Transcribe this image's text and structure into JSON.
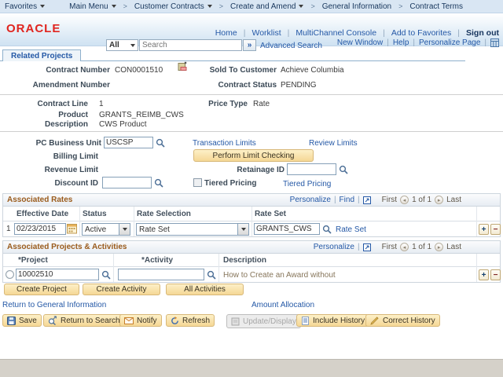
{
  "breadcrumb": {
    "items": [
      {
        "label": "Favorites",
        "has_menu": true
      },
      {
        "label": "Main Menu",
        "has_menu": true
      },
      {
        "label": "Customer Contracts",
        "has_menu": true
      },
      {
        "label": "Create and Amend",
        "has_menu": true
      },
      {
        "label": "General Information",
        "has_menu": false
      },
      {
        "label": "Contract Terms",
        "has_menu": false
      }
    ]
  },
  "header": {
    "logo": "ORACLE",
    "search_scope": "All",
    "search_placeholder": "Search",
    "advanced_search": "Advanced Search",
    "links": [
      "Home",
      "Worklist",
      "MultiChannel Console",
      "Add to Favorites"
    ],
    "sign_out": "Sign out"
  },
  "pagebar": {
    "links": [
      "New Window",
      "Help",
      "Personalize Page"
    ]
  },
  "tab": {
    "label": "Related Projects"
  },
  "contract": {
    "contract_number_label": "Contract Number",
    "contract_number": "CON0001510",
    "sold_to_label": "Sold To Customer",
    "sold_to": "Achieve Columbia",
    "amendment_label": "Amendment Number",
    "status_label": "Contract Status",
    "status": "PENDING",
    "line_label": "Contract Line",
    "line": "1",
    "price_type_label": "Price Type",
    "price_type": "Rate",
    "product_label": "Product",
    "product": "GRANTS_REIMB_CWS",
    "description_label": "Description",
    "description": "CWS Product"
  },
  "limits": {
    "pc_business_unit_label": "PC Business Unit",
    "pc_business_unit": "USCSP",
    "transaction_limits": "Transaction Limits",
    "review_limits": "Review Limits",
    "billing_limit_label": "Billing Limit",
    "perform_limit_checking": "Perform Limit Checking",
    "revenue_limit_label": "Revenue Limit",
    "retainage_id_label": "Retainage ID",
    "retainage_id": "",
    "discount_id_label": "Discount ID",
    "discount_id": "",
    "tiered_pricing_label": "Tiered Pricing",
    "tiered_pricing_link": "Tiered Pricing"
  },
  "rates": {
    "title": "Associated Rates",
    "personalize": "Personalize",
    "find": "Find",
    "first": "First",
    "count": "1 of 1",
    "last": "Last",
    "columns": [
      "Effective Date",
      "Status",
      "Rate Selection",
      "Rate Set"
    ],
    "row": {
      "num": "1",
      "effective_date": "02/23/2015",
      "status": "Active",
      "rate_selection": "Rate Set",
      "rate_set": "GRANTS_CWS",
      "rate_set_link": "Rate Set"
    }
  },
  "projects": {
    "title": "Associated Projects & Activities",
    "personalize": "Personalize",
    "first": "First",
    "count": "1 of 1",
    "last": "Last",
    "columns": [
      "*Project",
      "*Activity",
      "Description"
    ],
    "row": {
      "project": "10002510",
      "activity": "",
      "description": "How to Create an Award without"
    }
  },
  "actions": {
    "create_project": "Create Project",
    "create_activity": "Create Activity",
    "all_activities": "All Activities",
    "return_link": "Return to General Information",
    "amount_allocation": "Amount Allocation"
  },
  "toolbar": {
    "save": "Save",
    "return_to_search": "Return to Search",
    "notify": "Notify",
    "refresh": "Refresh",
    "update_display": "Update/Display",
    "include_history": "Include History",
    "correct_history": "Correct History"
  },
  "icons": {
    "add": "+",
    "remove": "−",
    "prev": "◂",
    "next": "▸",
    "go": "»"
  },
  "colors": {
    "link_blue": "#2458a6",
    "section_brown": "#9a5b1c",
    "button_tan": "#f5d795",
    "crumb_blue": "#d9e6f3",
    "header_blue": "#cfe2f2",
    "oracle_red": "#e0251f",
    "footer_gray": "#d5d1c9"
  }
}
